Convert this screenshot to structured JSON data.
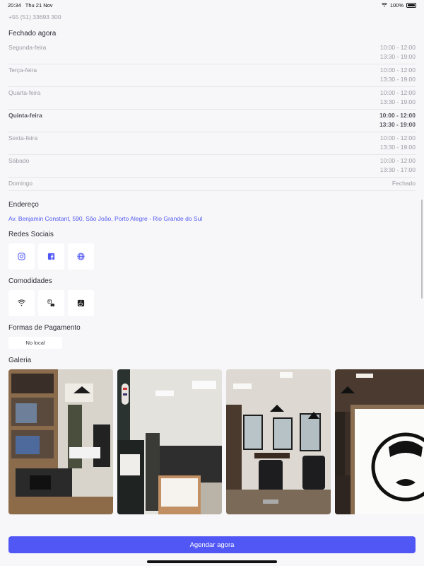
{
  "status_bar": {
    "time": "20:34",
    "date": "Thu 21 Nov",
    "battery": "100%"
  },
  "phone": "+55 (51) 33693 300",
  "hours_section": {
    "title": "Fechado agora",
    "rows": [
      {
        "day": "Segunda-feira",
        "t1": "10:00 - 12:00",
        "t2": "13:30 - 19:00"
      },
      {
        "day": "Terça-feira",
        "t1": "10:00 - 12:00",
        "t2": "13:30 - 19:00"
      },
      {
        "day": "Quarta-feira",
        "t1": "10:00 - 12:00",
        "t2": "13:30 - 19:00"
      },
      {
        "day": "Quinta-feira",
        "t1": "10:00 - 12:00",
        "t2": "13:30 - 19:00"
      },
      {
        "day": "Sexta-feira",
        "t1": "10:00 - 12:00",
        "t2": "13:30 - 19:00"
      },
      {
        "day": "Sábado",
        "t1": "10:00 - 12:00",
        "t2": "13:30 - 17:00"
      },
      {
        "day": "Domingo",
        "t1": "Fechado"
      }
    ]
  },
  "address_section": {
    "title": "Endereço",
    "text": "Av. Benjamin Constant, 590, São João, Porto Alegre - Rio Grande do Sul"
  },
  "social_section": {
    "title": "Redes Sociais",
    "items": [
      "instagram-icon",
      "facebook-icon",
      "globe-icon"
    ]
  },
  "amenities_section": {
    "title": "Comodidades",
    "items": [
      "wifi-icon",
      "parking-icon",
      "accessibility-icon"
    ]
  },
  "payment_section": {
    "title": "Formas de Pagamento",
    "chip": "No local"
  },
  "gallery_section": {
    "title": "Galeria"
  },
  "cta": {
    "label": "Agendar agora"
  },
  "colors": {
    "accent": "#5157f5",
    "link": "#5259f0",
    "background": "#f7f7fa"
  }
}
